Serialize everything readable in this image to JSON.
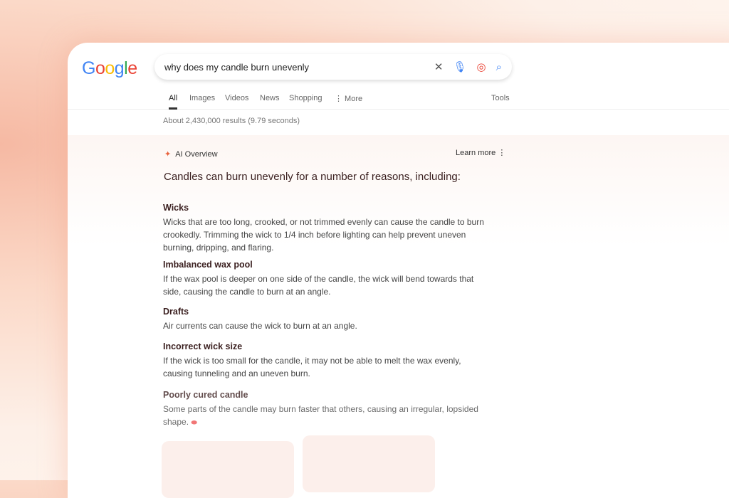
{
  "logo": "Google",
  "search": {
    "query": "why does my candle burn unevenly"
  },
  "tabs": [
    {
      "label": "All"
    },
    {
      "label": "Images"
    },
    {
      "label": "Videos"
    },
    {
      "label": "News"
    },
    {
      "label": "Shopping"
    },
    {
      "label": "⋮ More"
    }
  ],
  "tools": "Tools",
  "stats": "About 2,430,000 results (9.79 seconds)",
  "ai": {
    "title": "AI Overview",
    "learn_more": "Learn more",
    "lead": "Candles can burn unevenly for a number of reasons, including:",
    "sections": [
      {
        "heading": "Wicks",
        "text": "Wicks that are too long, crooked, or not trimmed evenly can cause the candle to burn crookedly. Trimming the wick to 1/4 inch before lighting can help prevent uneven burning, dripping, and flaring."
      },
      {
        "heading": "Imbalanced wax pool",
        "text": "If the wax pool is deeper on one side of the candle, the wick will bend towards that side, causing the candle to burn at an angle."
      },
      {
        "heading": "Drafts",
        "text": "Air currents can cause the wick to burn at an angle."
      },
      {
        "heading": "Incorrect wick size",
        "text": "If the wick is too small for the candle, it may not be able to melt the wax evenly, causing tunneling and an uneven burn."
      },
      {
        "heading": "Poorly cured candle",
        "text": "Some parts of the candle may burn faster that others, causing an irregular, lopsided shape."
      }
    ]
  },
  "colors": {
    "accent": "#e8613c",
    "heading": "#3a1f1f"
  }
}
